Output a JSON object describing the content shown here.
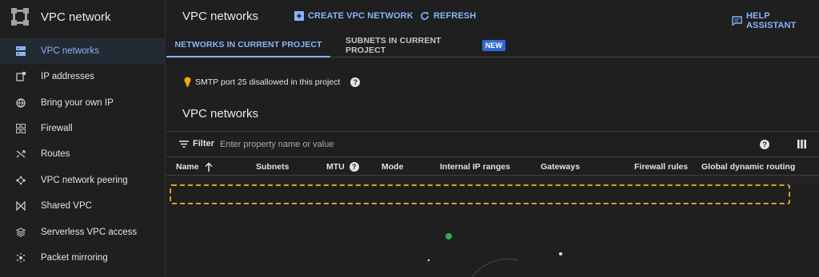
{
  "sidebar": {
    "title": "VPC network",
    "items": [
      {
        "label": "VPC networks",
        "icon": "vpc-networks-icon"
      },
      {
        "label": "IP addresses",
        "icon": "ip-addresses-icon"
      },
      {
        "label": "Bring your own IP",
        "icon": "globe-icon"
      },
      {
        "label": "Firewall",
        "icon": "firewall-icon"
      },
      {
        "label": "Routes",
        "icon": "routes-icon"
      },
      {
        "label": "VPC network peering",
        "icon": "peering-icon"
      },
      {
        "label": "Shared VPC",
        "icon": "shared-vpc-icon"
      },
      {
        "label": "Serverless VPC access",
        "icon": "serverless-icon"
      },
      {
        "label": "Packet mirroring",
        "icon": "packet-mirroring-icon"
      }
    ],
    "active_index": 0
  },
  "header": {
    "title": "VPC networks",
    "create_label": "CREATE VPC NETWORK",
    "refresh_label": "REFRESH",
    "help_label": "HELP ASSISTANT"
  },
  "tabs": [
    {
      "label": "NETWORKS IN CURRENT PROJECT"
    },
    {
      "label": "SUBNETS IN CURRENT PROJECT",
      "badge": "NEW"
    }
  ],
  "notice": {
    "text": "SMTP port 25 disallowed in this project"
  },
  "section": {
    "title": "VPC networks"
  },
  "filter": {
    "label": "Filter",
    "placeholder": "Enter property name or value"
  },
  "table": {
    "columns": [
      "Name",
      "Subnets",
      "MTU",
      "Mode",
      "Internal IP ranges",
      "Gateways",
      "Firewall rules",
      "Global dynamic routing"
    ]
  },
  "colors": {
    "accent": "#8ab4f8",
    "background": "#1f1f20",
    "highlight": "#e0a020",
    "bulb": "#f9ab00",
    "dot": "#34a853"
  }
}
